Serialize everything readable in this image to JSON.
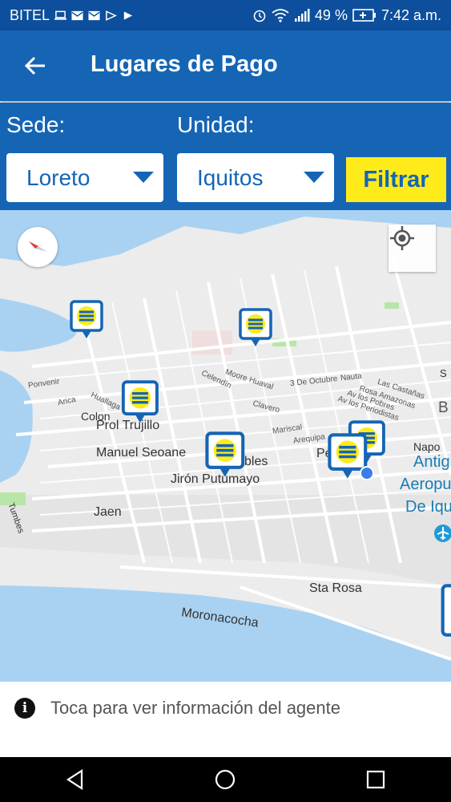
{
  "status_bar": {
    "carrier": "BITEL",
    "battery_percent": "49 %",
    "time": "7:42 a.m.",
    "icons": [
      "laptop-icon",
      "mail-icon",
      "mail-icon",
      "play-store-icon",
      "play-icon",
      "alarm-icon",
      "wifi-icon",
      "signal-icon",
      "battery-icon"
    ]
  },
  "app_bar": {
    "title": "Lugares de Pago",
    "back_icon": "arrow-back-icon"
  },
  "filters": {
    "sede_label": "Sede:",
    "unidad_label": "Unidad:",
    "sede_value": "Loreto",
    "unidad_value": "Iquitos",
    "filter_button": "Filtrar"
  },
  "map": {
    "street_labels": [
      "Manuel Seoane",
      "Jirón Putumayo",
      "Jaen",
      "Sta Rosa",
      "Moronacocha",
      "Colon",
      "Prol Trujillo",
      "Napo",
      "Tumbes",
      "Pe",
      "S",
      "B"
    ],
    "small_labels": [
      "Ponvenir",
      "Arica",
      "Huallaga",
      "Celendín",
      "Moore Huaval",
      "3 De Octubre",
      "Nauta",
      "Clavero",
      "Las Castañas",
      "Rosa Amazonas",
      "Av los Pobres",
      "Av los Periodistas",
      "Mariscal",
      "Arequipa",
      "bles"
    ],
    "airport_label": [
      "Antig",
      "Aeropu",
      "De Iqu"
    ],
    "pin_count": 7,
    "colors": {
      "water": "#a9d2f2",
      "land": "#ececec",
      "road": "#ffffff",
      "park": "#b8e6a8",
      "pin": "#1565b4",
      "pin_coin": "#ffeb1a"
    }
  },
  "info_bar": {
    "icon": "info-icon",
    "text": "Toca para ver información del agente"
  },
  "nav_bar": {
    "icons": [
      "back-triangle-icon",
      "home-circle-icon",
      "recents-square-icon"
    ]
  },
  "colors": {
    "primary": "#1565b4",
    "status_bar": "#0d4f9c",
    "accent": "#ffeb1a"
  }
}
